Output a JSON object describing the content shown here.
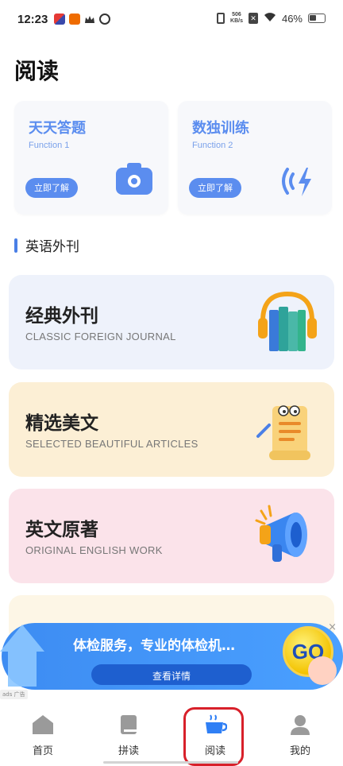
{
  "status_bar": {
    "time": "12:23",
    "net_speed_value": "506",
    "net_speed_unit": "KB/s",
    "battery": "46%"
  },
  "page": {
    "title": "阅读"
  },
  "functions": [
    {
      "title": "天天答题",
      "subtitle": "Function 1",
      "button": "立即了解",
      "icon": "camera-icon"
    },
    {
      "title": "数独训练",
      "subtitle": "Function 2",
      "button": "立即了解",
      "icon": "signal-icon"
    }
  ],
  "section": {
    "title": "英语外刊"
  },
  "journals": [
    {
      "title": "经典外刊",
      "subtitle": "CLASSIC FOREIGN JOURNAL",
      "icon": "books-headphones-icon"
    },
    {
      "title": "精选美文",
      "subtitle": "SELECTED BEAUTIFUL ARTICLES",
      "icon": "scroll-icon"
    },
    {
      "title": "英文原著",
      "subtitle": "ORIGINAL ENGLISH WORK",
      "icon": "megaphone-icon"
    }
  ],
  "ad": {
    "text": "体检服务，专业的体检机…",
    "button": "查看详情",
    "go": "GO",
    "close": "×",
    "tag": "ads 广告"
  },
  "nav": {
    "home": "首页",
    "pindu": "拼读",
    "yuedu": "阅读",
    "mine": "我的"
  },
  "colors": {
    "accent": "#5b8def",
    "highlight": "#d8202a"
  }
}
